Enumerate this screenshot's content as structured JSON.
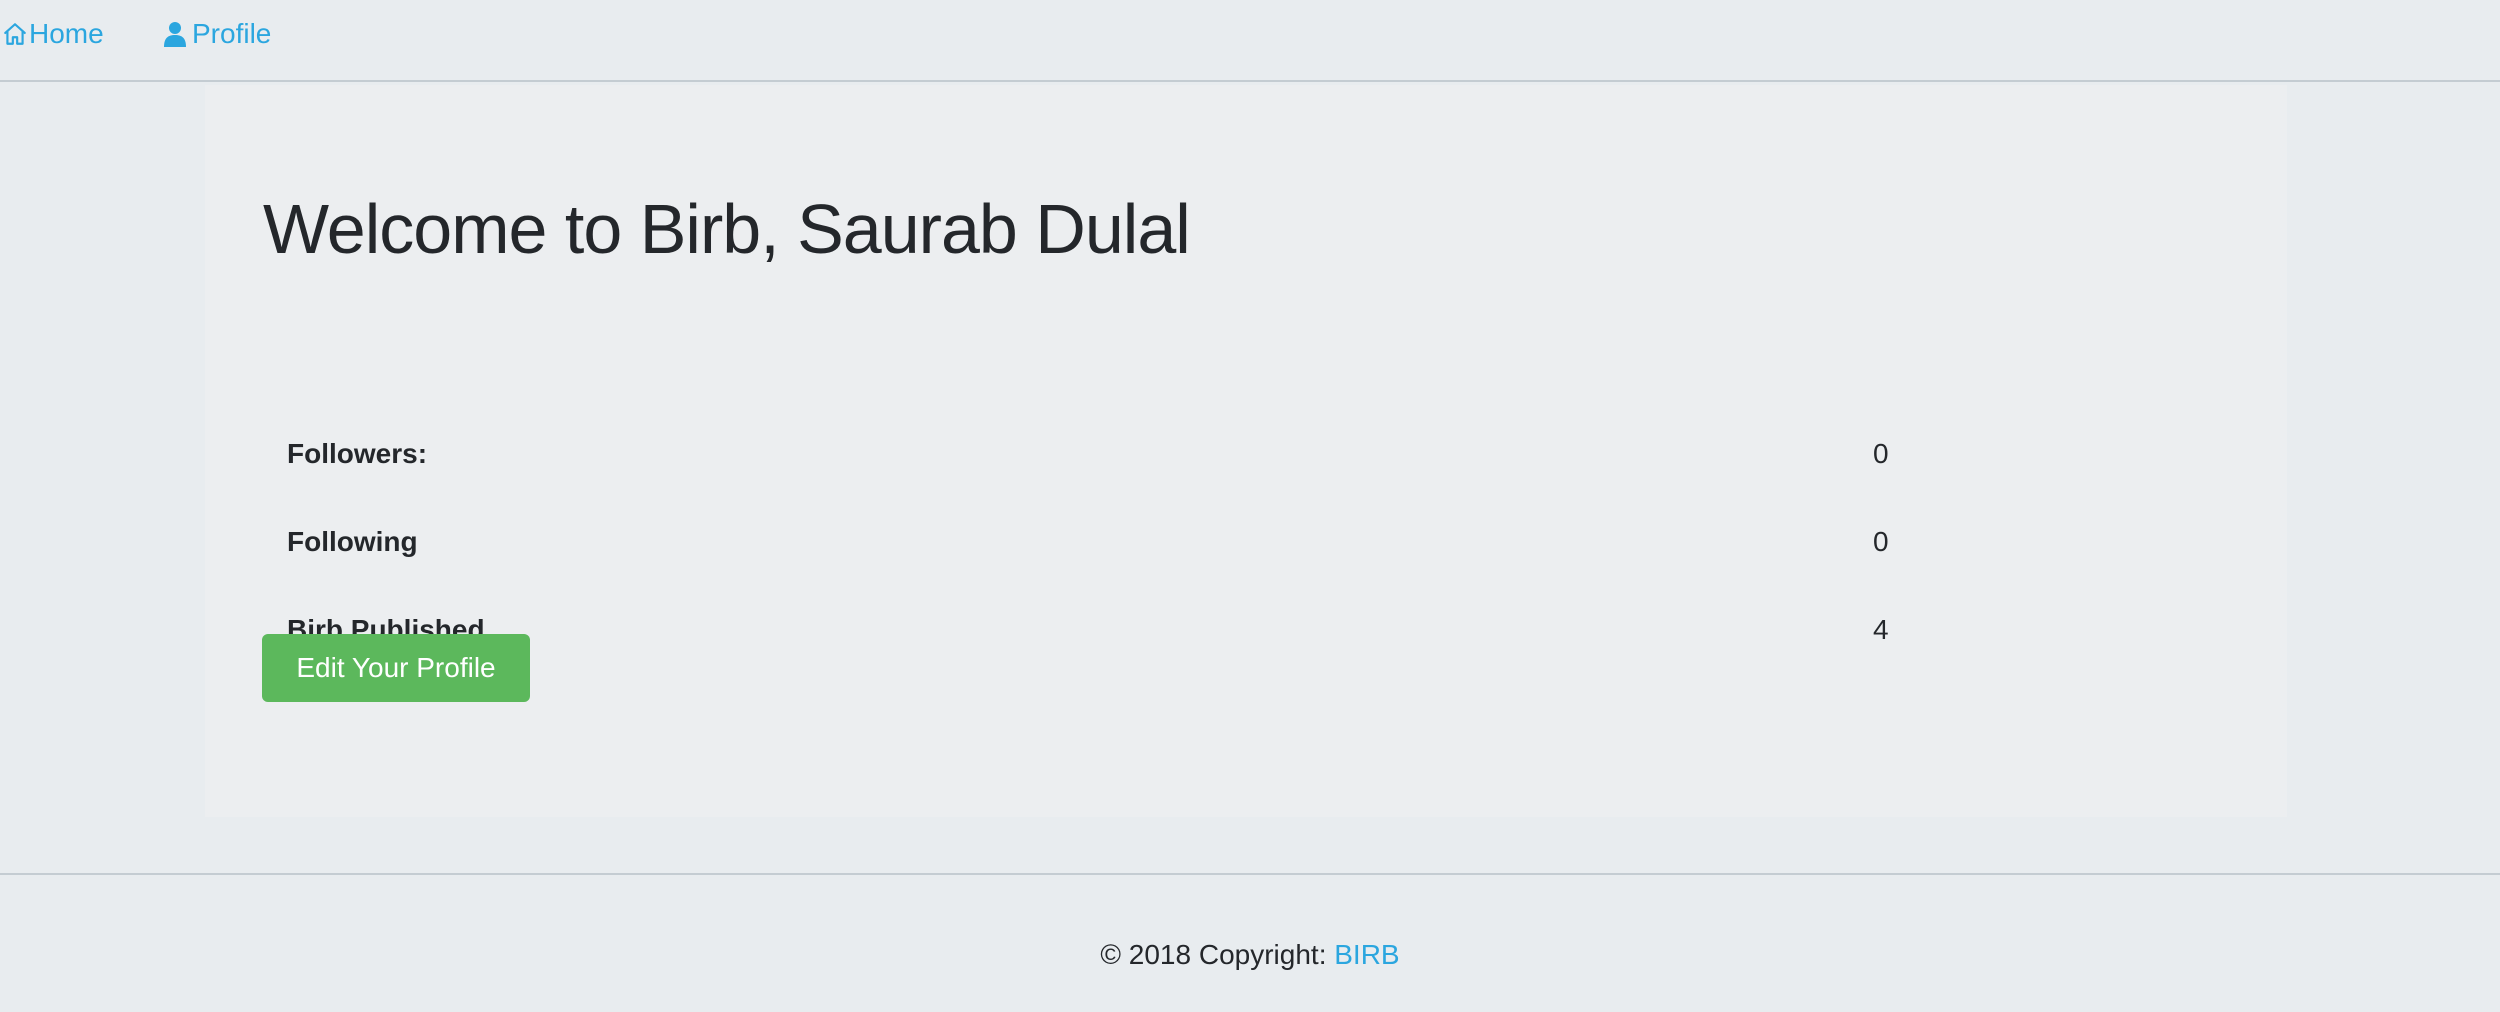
{
  "navbar": {
    "home_label": "Home",
    "home_icon": "home-icon",
    "profile_label": "Profile",
    "profile_icon": "user-icon",
    "link_color": "#2ba6df"
  },
  "jumbotron": {
    "title": "Welcome to Birb, Saurab Dulal",
    "stats": [
      {
        "label": "Followers:",
        "value": "0"
      },
      {
        "label": "Following",
        "value": "0"
      },
      {
        "label": "Birb Published",
        "value": "4"
      }
    ],
    "edit_button_label": "Edit Your Profile",
    "edit_button_color": "#5cb85c"
  },
  "footer": {
    "copyright_prefix": "© 2018 Copyright: ",
    "brand_link": "BIRB"
  }
}
